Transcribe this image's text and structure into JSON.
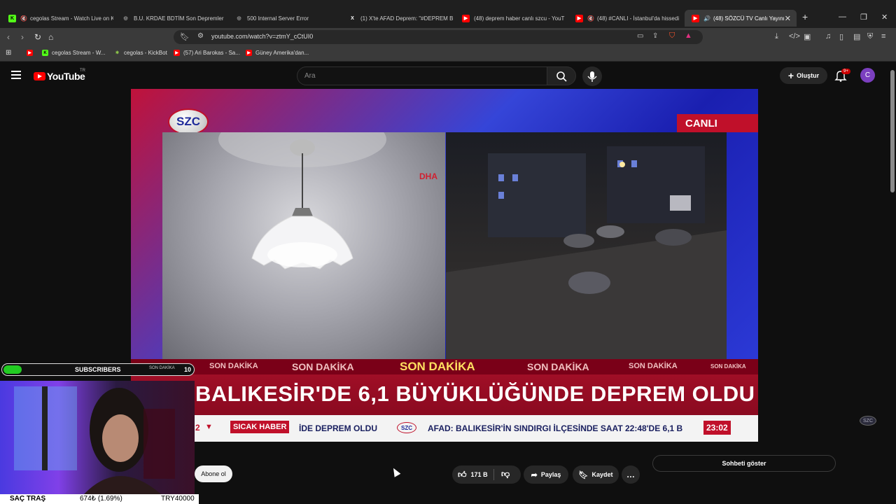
{
  "browser": {
    "tabs": [
      {
        "label": "cegolas Stream - Watch Live on K",
        "fav": "K",
        "favColor": "#53fc18"
      },
      {
        "label": "B.U. KRDAE BDTİM Son Depremler",
        "fav": "◎",
        "favColor": "#888888"
      },
      {
        "label": "500 Internal Server Error",
        "fav": "◎",
        "favColor": "#888888"
      },
      {
        "label": "(1) X'te AFAD Deprem: \"#DEPREM B",
        "fav": "X",
        "favColor": "#000000"
      },
      {
        "label": "(48) deprem haber canlı szcu - YouT",
        "fav": "▶",
        "favColor": "#ff0000"
      },
      {
        "label": "(48) #CANLI - İstanbul'da hissedi",
        "fav": "▶",
        "favColor": "#ff0000"
      },
      {
        "label": "(48) SÖZCÜ TV Canlı Yayını",
        "fav": "▶",
        "favColor": "#ff0000"
      }
    ],
    "new_tab": "+",
    "url": "youtube.com/watch?v=ztmY_cCtUI0",
    "bookmarks": [
      {
        "label": "",
        "fav": "▶",
        "favColor": "#ff0000"
      },
      {
        "label": "cegolas Stream - W...",
        "fav": "K",
        "favColor": "#53fc18"
      },
      {
        "label": "cegolas - KickBot",
        "fav": "✱",
        "favColor": "#8bc34a"
      },
      {
        "label": "(57) Ari Barokas - Sa...",
        "fav": "▶",
        "favColor": "#ff0000"
      },
      {
        "label": "Güney Amerika'dan...",
        "fav": "▶",
        "favColor": "#ff0000"
      }
    ]
  },
  "youtube": {
    "logo_text": "YouTube",
    "country": "TR",
    "search_placeholder": "Ara",
    "create_label": "Oluştur",
    "notif_badge": "9+",
    "avatar_letter": "C"
  },
  "video": {
    "logo": "SZC",
    "live_label": "CANLI",
    "dha_label": "DHA",
    "son_dakika": "SON DAKİKA",
    "headline": "BALIKESİR'DE 6,1 BÜYÜKLÜĞÜNDE DEPREM OLDU",
    "ticker_num": "2",
    "ticker_tag": "SICAK HABER",
    "ticker_text_1": "İDE DEPREM OLDU",
    "ticker_text_2": "AFAD: BALIKESİR'İN SINDIRGI İLÇESİNDE SAAT 22:48'DE 6,1 B",
    "ticker_time": "23:02"
  },
  "overlay": {
    "subscribers_label": "SUBSCRIBERS",
    "son_dakika_small": "SON DAKİKA",
    "subscriber_count": "10",
    "bottom_ticker": "SAÇ TRAŞ",
    "bottom_value": "674₺ (1.69%)",
    "bottom_goal": "TRY40000"
  },
  "actions": {
    "subscribe": "Abone ol",
    "likes": "171 B",
    "share": "Paylaş",
    "save": "Kaydet",
    "more": "…",
    "show_chat": "Sohbeti göster"
  }
}
